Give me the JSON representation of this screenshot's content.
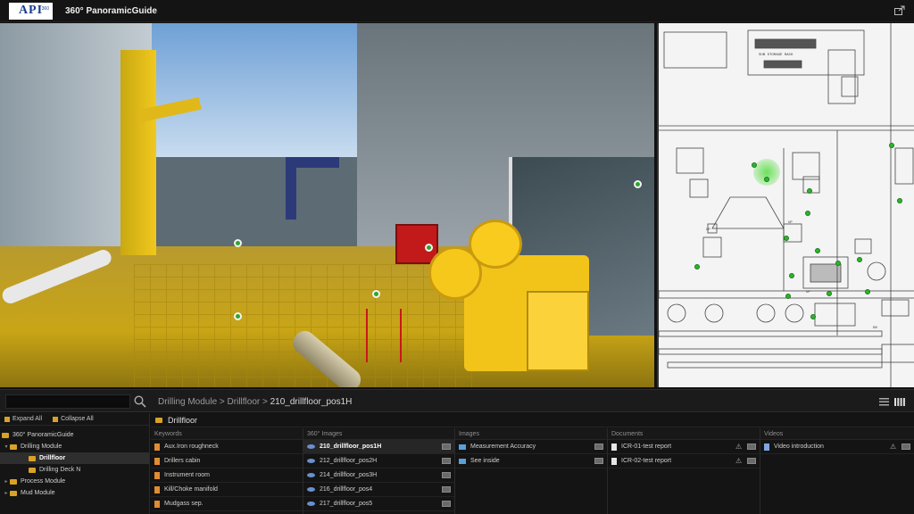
{
  "header": {
    "logo_text": "API",
    "logo_sub": "360",
    "title": "360° PanoramicGuide"
  },
  "search": {
    "placeholder": ""
  },
  "breadcrumb": {
    "parts": [
      "Drilling Module",
      "Drillfloor",
      "210_drillfloor_pos1H"
    ],
    "separator": ">"
  },
  "tree": {
    "expand_all": "Expand All",
    "collapse_all": "Collapse All",
    "items": [
      {
        "label": "360° PanoramicGuide"
      },
      {
        "label": "Drilling Module"
      },
      {
        "label": "Drillfloor"
      },
      {
        "label": "Drilling Deck N"
      },
      {
        "label": "Process Module"
      },
      {
        "label": "Mud Module"
      }
    ]
  },
  "content": {
    "section_title": "Drillfloor",
    "columns": {
      "keywords": {
        "header": "Keywords",
        "items": [
          "Aux.Iron roughneck",
          "Drillers cabin",
          "Instrument room",
          "Kill/Choke manifold",
          "Mudgass sep."
        ]
      },
      "images360": {
        "header": "360° Images",
        "items": [
          "210_drillfloor_pos1H",
          "212_drillfloor_pos2H",
          "214_drillfloor_pos3H",
          "216_drillfloor_pos4",
          "217_drillfloor_pos5"
        ]
      },
      "images": {
        "header": "Images",
        "items": [
          "Measurement Accuracy",
          "See inside"
        ]
      },
      "documents": {
        "header": "Documents",
        "items": [
          "ICR-01-test report",
          "ICR-02-test report"
        ]
      },
      "videos": {
        "header": "Videos",
        "items": [
          "Video introduction"
        ]
      }
    }
  },
  "map": {
    "label_storage": "SUB STORAGE RACK",
    "label_up": "UP",
    "label_dn": "DN"
  },
  "colors": {
    "node_green": "#2ea52e",
    "folder": "#d9a227",
    "accent_blue": "#1a3d8f"
  }
}
